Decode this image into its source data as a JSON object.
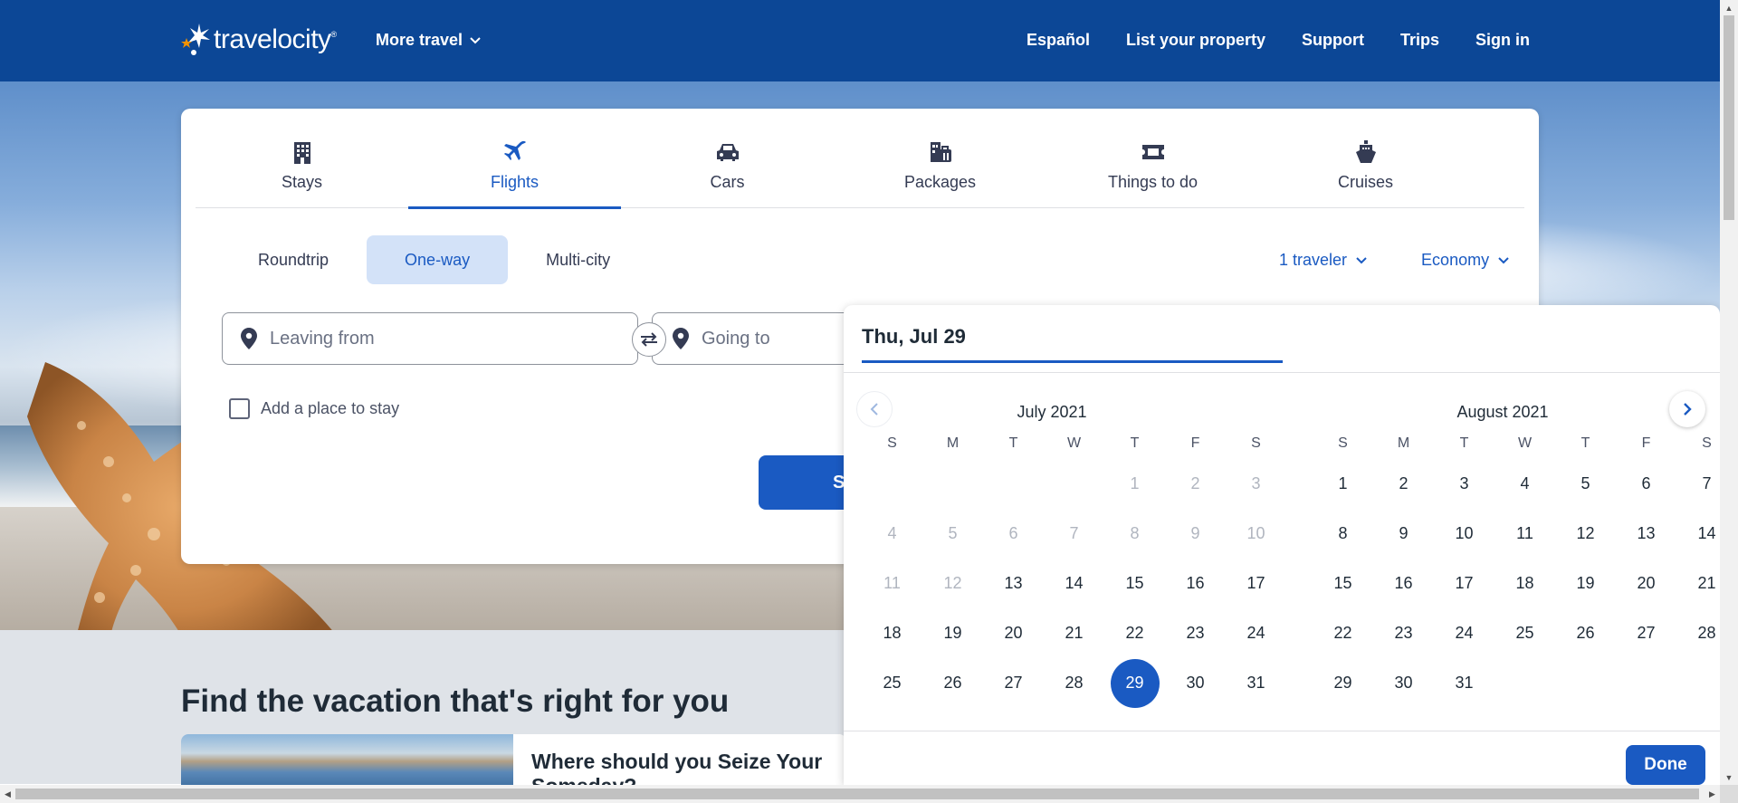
{
  "header": {
    "logo_text": "travelocity",
    "more_travel": "More travel",
    "nav": [
      "Español",
      "List your property",
      "Support",
      "Trips",
      "Sign in"
    ]
  },
  "tabs": [
    {
      "label": "Stays",
      "icon": "building-icon"
    },
    {
      "label": "Flights",
      "icon": "plane-icon",
      "active": true
    },
    {
      "label": "Cars",
      "icon": "car-icon"
    },
    {
      "label": "Packages",
      "icon": "packages-icon"
    },
    {
      "label": "Things to do",
      "icon": "ticket-icon"
    },
    {
      "label": "Cruises",
      "icon": "ship-icon"
    }
  ],
  "trip_types": [
    "Roundtrip",
    "One-way",
    "Multi-city"
  ],
  "selected_trip_type": "One-way",
  "travelers": "1 traveler",
  "cabin_class": "Economy",
  "fields": {
    "leaving_placeholder": "Leaving from",
    "going_placeholder": "Going to"
  },
  "add_place": "Add a place to stay",
  "search_button": "S",
  "section_heading": "Find the vacation that's right for you",
  "promo_title": "Where should you Seize Your Someday?",
  "datepicker": {
    "selected_date": "Thu, Jul 29",
    "weekday_headers": [
      "S",
      "M",
      "T",
      "W",
      "T",
      "F",
      "S"
    ],
    "months": [
      {
        "title": "July 2021",
        "offset": 4,
        "days": 31,
        "disabled_until": 12,
        "selected": 29
      },
      {
        "title": "August 2021",
        "offset": 0,
        "days": 31,
        "disabled_until": 0,
        "selected": null
      }
    ],
    "done_label": "Done"
  },
  "colors": {
    "brand_blue": "#0c4796",
    "accent_blue": "#1a5ac2",
    "selected_bg": "#d3e2f8"
  }
}
